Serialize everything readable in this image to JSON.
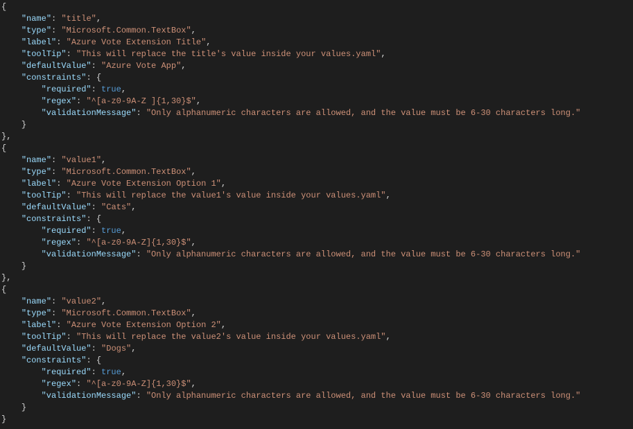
{
  "theme": "vscode-dark",
  "colors": {
    "background": "#1e1e1e",
    "default": "#d4d4d4",
    "property": "#9cdcfe",
    "string": "#ce9178",
    "boolean": "#569cd6"
  },
  "objects": [
    {
      "name": "title",
      "type": "Microsoft.Common.TextBox",
      "label": "Azure Vote Extension Title",
      "toolTip": "This will replace the title's value inside your values.yaml",
      "defaultValue": "Azure Vote App",
      "constraints": {
        "required": true,
        "regex": "^[a-z0-9A-Z ]{1,30}$",
        "validationMessage": "Only alphanumeric characters are allowed, and the value must be 6-30 characters long."
      },
      "trailingComma": true
    },
    {
      "name": "value1",
      "type": "Microsoft.Common.TextBox",
      "label": "Azure Vote Extension Option 1",
      "toolTip": "This will replace the value1's value inside your values.yaml",
      "defaultValue": "Cats",
      "constraints": {
        "required": true,
        "regex": "^[a-z0-9A-Z]{1,30}$",
        "validationMessage": "Only alphanumeric characters are allowed, and the value must be 6-30 characters long."
      },
      "trailingComma": true
    },
    {
      "name": "value2",
      "type": "Microsoft.Common.TextBox",
      "label": "Azure Vote Extension Option 2",
      "toolTip": "This will replace the value2's value inside your values.yaml",
      "defaultValue": "Dogs",
      "constraints": {
        "required": true,
        "regex": "^[a-z0-9A-Z]{1,30}$",
        "validationMessage": "Only alphanumeric characters are allowed, and the value must be 6-30 characters long."
      },
      "trailingComma": false
    }
  ],
  "keys": {
    "name": "name",
    "type": "type",
    "label": "label",
    "toolTip": "toolTip",
    "defaultValue": "defaultValue",
    "constraints": "constraints",
    "required": "required",
    "regex": "regex",
    "validationMessage": "validationMessage"
  }
}
